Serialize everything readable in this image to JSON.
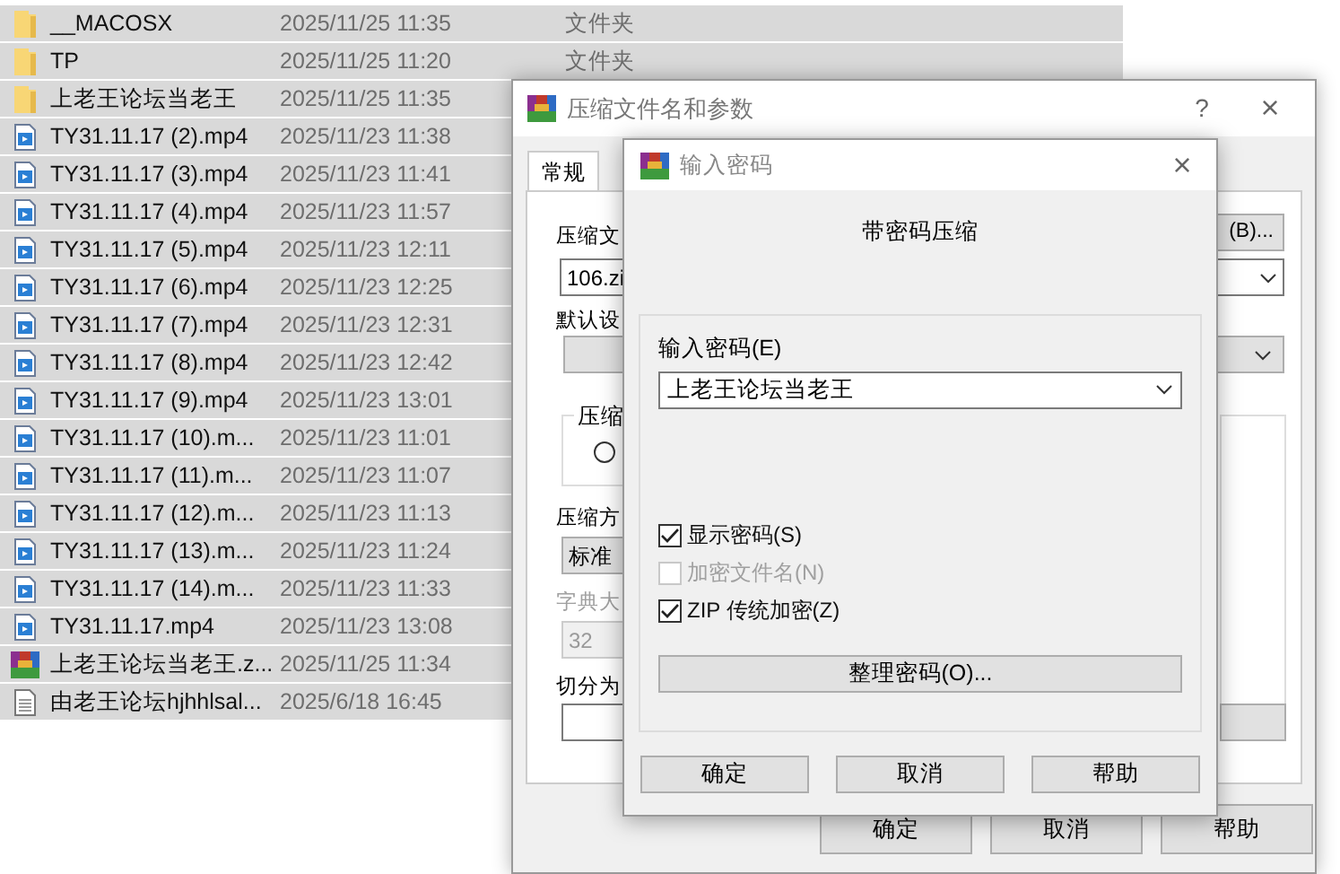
{
  "files": [
    {
      "name": "__MACOSX",
      "date": "2025/11/25 11:35",
      "type": "文件夹",
      "kind": "folder",
      "selected": true
    },
    {
      "name": "TP",
      "date": "2025/11/25 11:20",
      "type": "文件夹",
      "kind": "folder",
      "selected": true
    },
    {
      "name": "上老王论坛当老王",
      "date": "2025/11/25 11:35",
      "kind": "folder",
      "selected": true
    },
    {
      "name": "TY31.11.17 (2).mp4",
      "date": "2025/11/23 11:38",
      "kind": "video",
      "selected": true
    },
    {
      "name": "TY31.11.17 (3).mp4",
      "date": "2025/11/23 11:41",
      "kind": "video",
      "selected": true
    },
    {
      "name": "TY31.11.17 (4).mp4",
      "date": "2025/11/23 11:57",
      "kind": "video",
      "selected": true
    },
    {
      "name": "TY31.11.17 (5).mp4",
      "date": "2025/11/23 12:11",
      "kind": "video",
      "selected": true
    },
    {
      "name": "TY31.11.17 (6).mp4",
      "date": "2025/11/23 12:25",
      "kind": "video",
      "selected": true
    },
    {
      "name": "TY31.11.17 (7).mp4",
      "date": "2025/11/23 12:31",
      "kind": "video",
      "selected": true
    },
    {
      "name": "TY31.11.17 (8).mp4",
      "date": "2025/11/23 12:42",
      "kind": "video",
      "selected": true
    },
    {
      "name": "TY31.11.17 (9).mp4",
      "date": "2025/11/23 13:01",
      "kind": "video",
      "selected": true
    },
    {
      "name": "TY31.11.17 (10).m...",
      "date": "2025/11/23 11:01",
      "kind": "video",
      "selected": true
    },
    {
      "name": "TY31.11.17 (11).m...",
      "date": "2025/11/23 11:07",
      "kind": "video",
      "selected": true
    },
    {
      "name": "TY31.11.17 (12).m...",
      "date": "2025/11/23 11:13",
      "kind": "video",
      "selected": true
    },
    {
      "name": "TY31.11.17 (13).m...",
      "date": "2025/11/23 11:24",
      "kind": "video",
      "selected": true
    },
    {
      "name": "TY31.11.17 (14).m...",
      "date": "2025/11/23 11:33",
      "kind": "video",
      "selected": true
    },
    {
      "name": "TY31.11.17.mp4",
      "date": "2025/11/23 13:08",
      "kind": "video",
      "selected": true
    },
    {
      "name": "上老王论坛当老王.z...",
      "date": "2025/11/25 11:34",
      "kind": "archive",
      "selected": true
    },
    {
      "name": "由老王论坛hjhhlsal...",
      "date": "2025/6/18 16:45",
      "kind": "text",
      "selected": true
    }
  ],
  "compress_dialog": {
    "title": "压缩文件名和参数",
    "help": "?",
    "close": "×",
    "tabs": [
      {
        "label": "常规",
        "selected": true
      }
    ],
    "archive_label": "压缩文",
    "browse_button": "(B)...",
    "archive_name": "106.zi",
    "profile_label": "默认设",
    "format_group": "压缩",
    "format_option": {
      "checked": false
    },
    "method_label": "压缩方",
    "method_value": "标准",
    "dict_label": "字典大",
    "dict_value": "32",
    "split_label": "切分为",
    "buttons": [
      "确定",
      "取消",
      "帮助"
    ]
  },
  "password_dialog": {
    "title": "输入密码",
    "close": "×",
    "heading": "带密码压缩",
    "password_label": "输入密码(E)",
    "password": "上老王论坛当老王",
    "options": [
      {
        "label": "显示密码(S)",
        "checked": true,
        "disabled": false
      },
      {
        "label": "加密文件名(N)",
        "checked": false,
        "disabled": true
      },
      {
        "label": "ZIP 传统加密(Z)",
        "checked": true,
        "disabled": false
      }
    ],
    "organize_button": "整理密码(O)...",
    "buttons": [
      "确定",
      "取消",
      "帮助"
    ]
  }
}
